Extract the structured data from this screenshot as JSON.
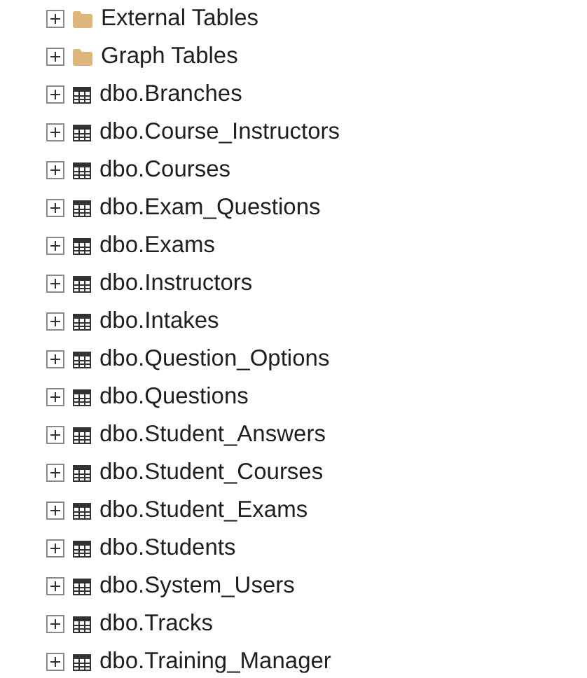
{
  "tree": {
    "items": [
      {
        "kind": "folder",
        "label": "External Tables",
        "expanded": false
      },
      {
        "kind": "folder",
        "label": "Graph Tables",
        "expanded": false
      },
      {
        "kind": "table",
        "label": "dbo.Branches",
        "expanded": false
      },
      {
        "kind": "table",
        "label": "dbo.Course_Instructors",
        "expanded": false
      },
      {
        "kind": "table",
        "label": "dbo.Courses",
        "expanded": false
      },
      {
        "kind": "table",
        "label": "dbo.Exam_Questions",
        "expanded": false
      },
      {
        "kind": "table",
        "label": "dbo.Exams",
        "expanded": false
      },
      {
        "kind": "table",
        "label": "dbo.Instructors",
        "expanded": false
      },
      {
        "kind": "table",
        "label": "dbo.Intakes",
        "expanded": false
      },
      {
        "kind": "table",
        "label": "dbo.Question_Options",
        "expanded": false
      },
      {
        "kind": "table",
        "label": "dbo.Questions",
        "expanded": false
      },
      {
        "kind": "table",
        "label": "dbo.Student_Answers",
        "expanded": false
      },
      {
        "kind": "table",
        "label": "dbo.Student_Courses",
        "expanded": false
      },
      {
        "kind": "table",
        "label": "dbo.Student_Exams",
        "expanded": false
      },
      {
        "kind": "table",
        "label": "dbo.Students",
        "expanded": false
      },
      {
        "kind": "table",
        "label": "dbo.System_Users",
        "expanded": false
      },
      {
        "kind": "table",
        "label": "dbo.Tracks",
        "expanded": false
      },
      {
        "kind": "table",
        "label": "dbo.Training_Manager",
        "expanded": false
      }
    ]
  }
}
